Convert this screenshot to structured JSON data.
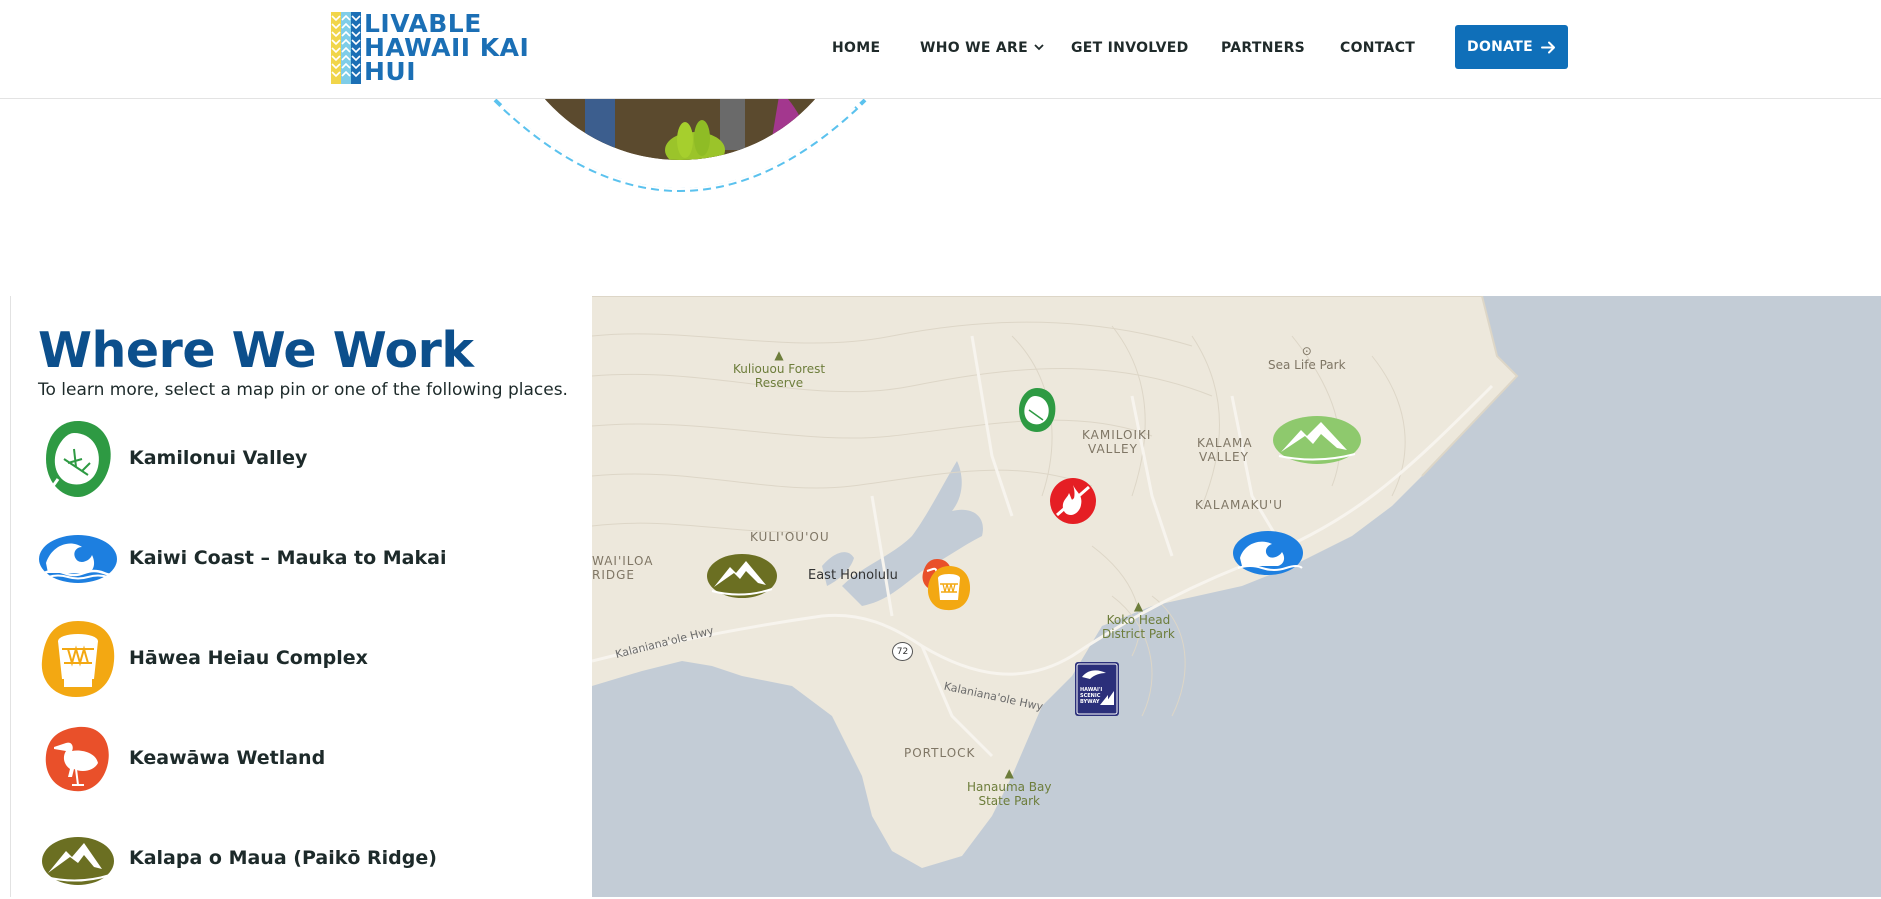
{
  "header": {
    "logo": {
      "line1": "LIVABLE",
      "line2": "HAWAII KAI",
      "line3": "HUI"
    },
    "nav": [
      {
        "label": "HOME"
      },
      {
        "label": "WHO WE ARE",
        "has_dropdown": true
      },
      {
        "label": "GET INVOLVED"
      },
      {
        "label": "PARTNERS"
      },
      {
        "label": "CONTACT"
      }
    ],
    "donate_label": "DONATE",
    "donate_icon": "arrow-right-icon"
  },
  "where_we_work": {
    "title": "Where We Work",
    "subtitle": "To learn more, select a map pin or one of the following places.",
    "places": [
      {
        "label": "Kamilonui Valley",
        "icon": "taro-leaf-icon",
        "color": "#2e9a43"
      },
      {
        "label": "Kaiwi Coast – Mauka to Makai",
        "icon": "wave-icon",
        "color": "#1d7fe0"
      },
      {
        "label": "Hāwea Heiau Complex",
        "icon": "drum-icon",
        "color": "#f3a812"
      },
      {
        "label": "Keawāwa Wetland",
        "icon": "bird-icon",
        "color": "#e9502a"
      },
      {
        "label": "Kalapa o Maua (Paikō Ridge)",
        "icon": "mountain-icon",
        "color": "#6b6f22"
      }
    ]
  },
  "map": {
    "area_labels": {
      "kuliouou": "KULI'OU'OU",
      "waialae_1": "WAI'ILOA",
      "waialae_2": "RIDGE",
      "kamiloiki_1": "KAMILOIKI",
      "kamiloiki_2": "VALLEY",
      "kalama_1": "KALAMA",
      "kalama_2": "VALLEY",
      "kalamakua": "KALAMAKU'U",
      "portlock": "PORTLOCK"
    },
    "parks": {
      "kuliouou_forest_1": "Kuliouou Forest",
      "kuliouou_forest_2": "Reserve",
      "sea_life_park": "Sea Life Park",
      "koko_head_1": "Koko Head",
      "koko_head_2": "District Park",
      "hanauma_1": "Hanauma Bay",
      "hanauma_2": "State Park"
    },
    "town": "East Honolulu",
    "roads": {
      "road_west": "Kalaniana'ole Hwy",
      "road_east": "Kalaniana'ole Hwy",
      "route_shield": "72"
    },
    "byway_sign": {
      "line1": "HAWAI'I",
      "line2": "SCENIC",
      "line3": "BYWAY"
    },
    "colors": {
      "land": "#ede8dc",
      "water": "#c3ccd6",
      "contour": "#d8d2c4",
      "road": "#f7f4ee"
    }
  },
  "colors": {
    "brand_blue": "#0c4f8c",
    "donate_blue": "#0f6fb9",
    "chevron_blue": "#5bc2ee"
  }
}
